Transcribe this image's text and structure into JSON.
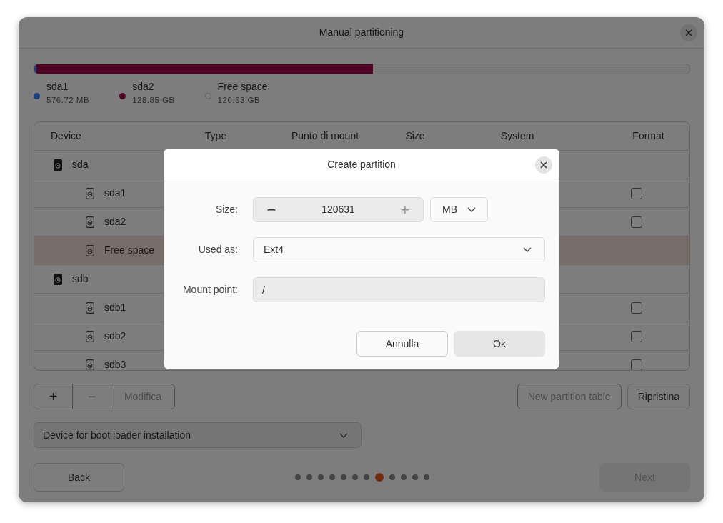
{
  "window": {
    "title": "Manual partitioning"
  },
  "legend": [
    {
      "name": "sda1",
      "size": "576.72 MB",
      "kind": "used",
      "color": "#1c3f7a",
      "level": 0.003
    },
    {
      "name": "sda2",
      "size": "128.85 GB",
      "kind": "used",
      "color": "#4f0222",
      "level": 0.514
    },
    {
      "name": "Free space",
      "size": "120.63 GB",
      "kind": "free"
    }
  ],
  "table": {
    "columns": [
      "Device",
      "Type",
      "Punto di mount",
      "Size",
      "System",
      "Format"
    ],
    "rows": [
      {
        "device": "sda",
        "kind": "disk",
        "selected": false,
        "children": [
          {
            "device": "sda1",
            "kind": "partition",
            "selected": false,
            "format": false
          },
          {
            "device": "sda2",
            "kind": "partition",
            "selected": false,
            "format": false
          },
          {
            "device": "Free space",
            "kind": "partition",
            "selected": true
          }
        ]
      },
      {
        "device": "sdb",
        "kind": "disk",
        "selected": false,
        "children": [
          {
            "device": "sdb1",
            "kind": "partition",
            "selected": false,
            "format": false
          },
          {
            "device": "sdb2",
            "kind": "partition",
            "selected": false,
            "format": false
          },
          {
            "device": "sdb3",
            "kind": "partition",
            "selected": false,
            "format": false
          }
        ]
      }
    ]
  },
  "edit_buttons": [
    {
      "label": "+",
      "disabled": false
    },
    {
      "label": "−",
      "disabled": true
    },
    {
      "label": "Modifica",
      "disabled": true
    }
  ],
  "table_buttons": [
    {
      "label": "New partition table",
      "disabled": true
    },
    {
      "label": "Ripristina",
      "disabled": false
    }
  ],
  "boot_loader": {
    "label": "Device for boot loader installation"
  },
  "footer": {
    "back": {
      "label": "Back",
      "disabled": false
    },
    "next": {
      "label": "Next",
      "disabled": true
    },
    "steps": [
      {
        "selected": false
      },
      {
        "selected": false
      },
      {
        "selected": false
      },
      {
        "selected": false
      },
      {
        "selected": false
      },
      {
        "selected": false
      },
      {
        "selected": false
      },
      {
        "selected": true
      },
      {
        "selected": false
      },
      {
        "selected": false
      },
      {
        "selected": false
      },
      {
        "selected": false
      }
    ]
  },
  "dialog": {
    "title": "Create partition",
    "size": {
      "label": "Size:",
      "value": "120631",
      "unit": "MB",
      "steppers": [
        {
          "label": "−",
          "disabled": false
        },
        {
          "label": "+",
          "disabled": true
        }
      ]
    },
    "used_as": {
      "label": "Used as:",
      "value": "Ext4"
    },
    "mount_point": {
      "label": "Mount point:",
      "value": "/"
    },
    "buttons": [
      {
        "label": "Annulla",
        "kind": "secondary"
      },
      {
        "label": "Ok",
        "kind": "primary"
      }
    ]
  }
}
